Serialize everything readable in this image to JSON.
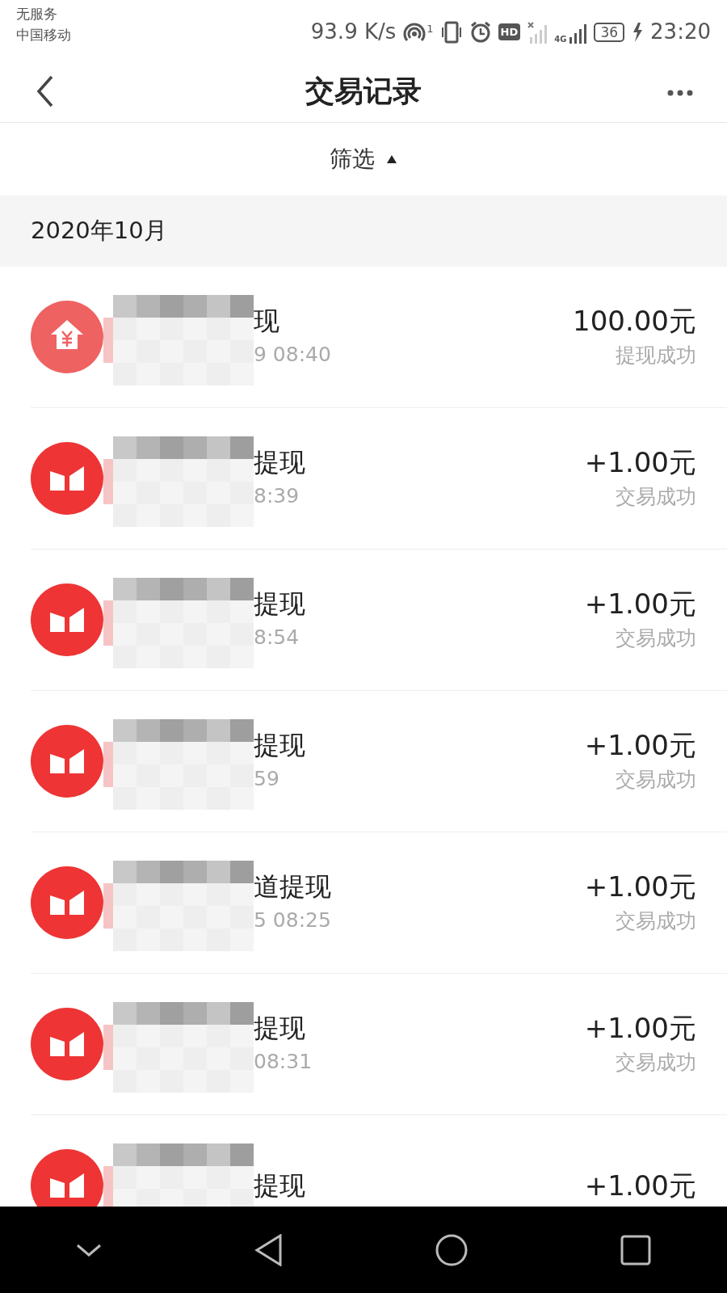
{
  "status_bar": {
    "carrier_lines": [
      "无服务",
      "中国移动"
    ],
    "speed": "93.9 K/s",
    "hotspot_badge": "1",
    "hd": "HD",
    "network": "4G",
    "battery": "36",
    "time": "23:20"
  },
  "header": {
    "title": "交易记录"
  },
  "filter": {
    "label": "筛选",
    "expanded": true
  },
  "month": "2020年10月",
  "transactions": [
    {
      "kind": "house",
      "title": "现",
      "time": "9 08:40",
      "amount": "100.00元",
      "status": "提现成功"
    },
    {
      "kind": "book",
      "title": "提现",
      "time": "8:39",
      "amount": "+1.00元",
      "status": "交易成功"
    },
    {
      "kind": "book",
      "title": "提现",
      "time": "8:54",
      "amount": "+1.00元",
      "status": "交易成功"
    },
    {
      "kind": "book",
      "title": "提现",
      "time": "59",
      "amount": "+1.00元",
      "status": "交易成功"
    },
    {
      "kind": "book",
      "title": "道提现",
      "time": "5 08:25",
      "amount": "+1.00元",
      "status": "交易成功"
    },
    {
      "kind": "book",
      "title": "提现",
      "time": "08:31",
      "amount": "+1.00元",
      "status": "交易成功"
    },
    {
      "kind": "book",
      "title": "提现",
      "amount": "+1.00元"
    }
  ]
}
